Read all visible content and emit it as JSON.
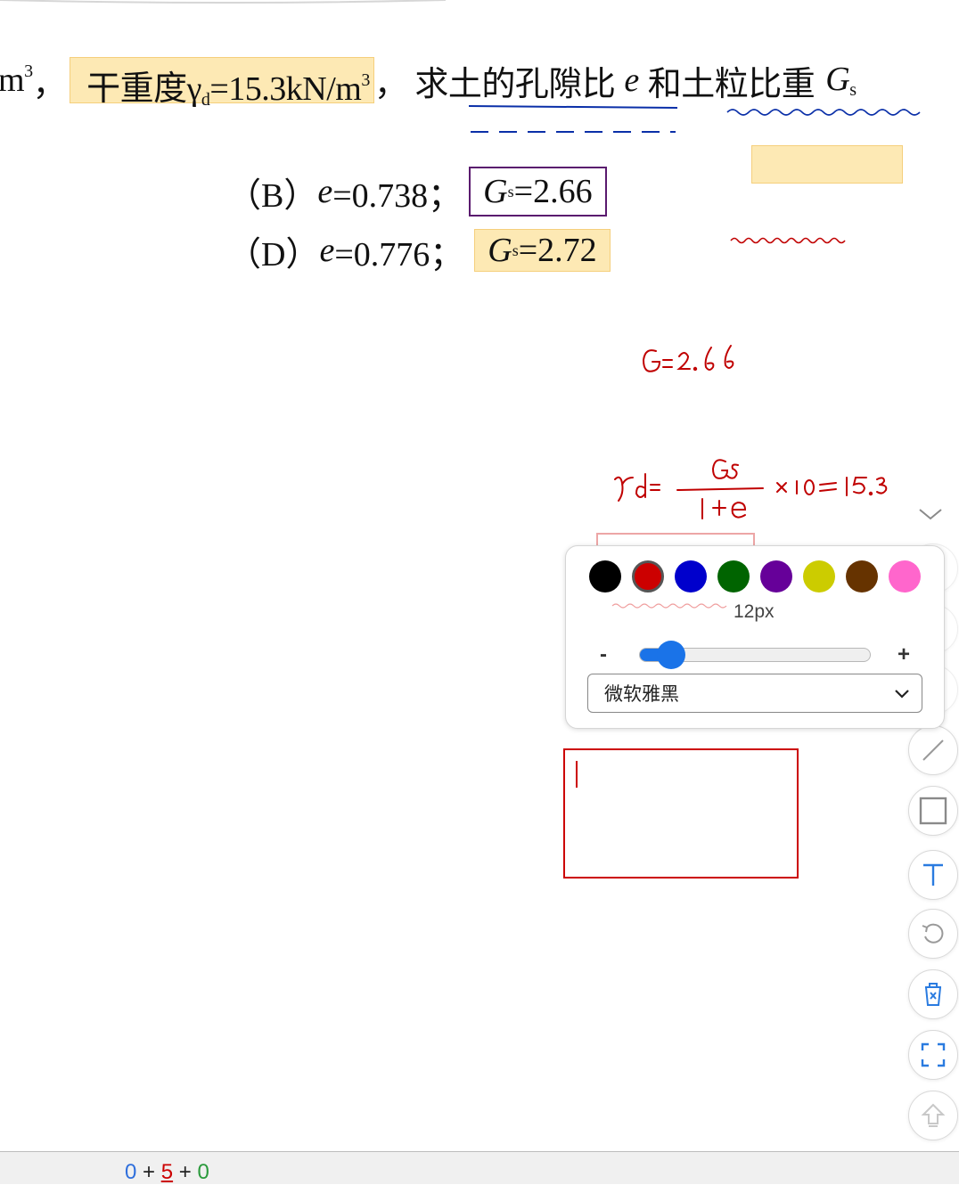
{
  "question": {
    "prefix_unit": "m",
    "prefix_sup": "3",
    "comma1": "，",
    "dry_unit_weight_label": "干重度γ",
    "dry_unit_weight_sub": "d",
    "dry_unit_weight_value": "=15.3kN/m",
    "dry_unit_weight_sup": "3",
    "comma2": "，",
    "ask_part1": "求土的孔隙比",
    "ask_e": "e",
    "ask_part2": "和土粒比重",
    "ask_G": "G",
    "ask_G_sub": "s"
  },
  "options": [
    {
      "label": "（B）",
      "e_symbol": "e",
      "e_value": "=0.738；",
      "g_symbol": "G",
      "g_sub": "s",
      "g_value": "=2.66"
    },
    {
      "label": "（D）",
      "e_symbol": "e",
      "e_value": "=0.776；",
      "g_symbol": "G",
      "g_sub": "s",
      "g_value": "=2.72"
    }
  ],
  "colors": {
    "highlight": "#fde9b4",
    "ink_red": "#c00000",
    "ink_blue": "#0a2fa8",
    "box_purple": "#5a1a6e"
  },
  "palette": {
    "swatches": [
      {
        "name": "black",
        "color": "#000000",
        "selected": false
      },
      {
        "name": "red",
        "color": "#cc0000",
        "selected": true
      },
      {
        "name": "blue",
        "color": "#0000cc",
        "selected": false
      },
      {
        "name": "green",
        "color": "#006400",
        "selected": false
      },
      {
        "name": "purple",
        "color": "#660099",
        "selected": false
      },
      {
        "name": "yellow",
        "color": "#cccc00",
        "selected": false
      },
      {
        "name": "brown",
        "color": "#663300",
        "selected": false
      },
      {
        "name": "pink",
        "color": "#ff66cc",
        "selected": false
      }
    ],
    "size_label": "12px",
    "minus_label": "-",
    "plus_label": "+",
    "size_level_fraction": 0.14,
    "font_value": "微软雅黑"
  },
  "toolbar": {
    "tools": [
      "select-icon",
      "pen-icon",
      "eraser-icon",
      "line-icon",
      "rectangle-icon",
      "text-icon",
      "undo-icon",
      "delete-icon",
      "fullscreen-icon",
      "upload-icon"
    ]
  },
  "bottom": {
    "n1": "0",
    "plus1": " + ",
    "n2": "5",
    "plus2": " + ",
    "n3": "0"
  }
}
